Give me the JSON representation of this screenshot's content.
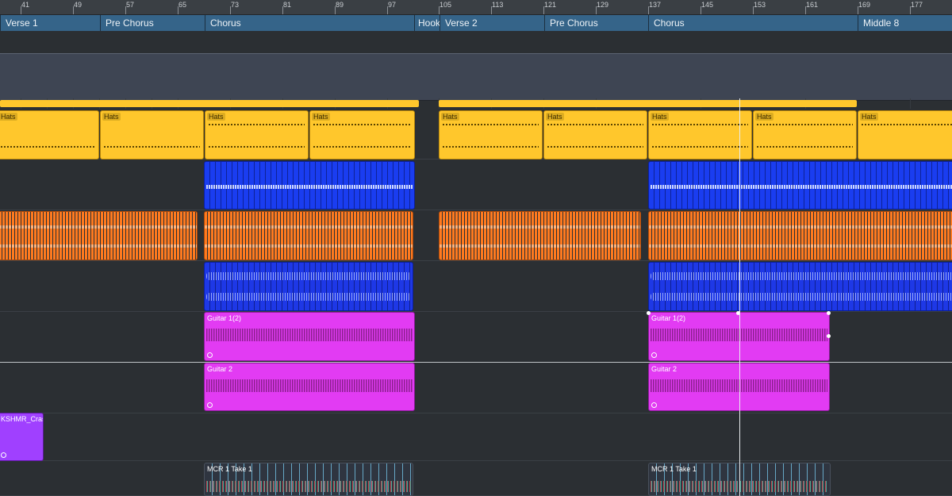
{
  "ruler": {
    "ticks": [
      "41",
      "49",
      "57",
      "65",
      "73",
      "81",
      "89",
      "97",
      "105",
      "113",
      "121",
      "129",
      "137",
      "145",
      "153",
      "161",
      "169",
      "177"
    ]
  },
  "markers": [
    {
      "label": "Verse 1"
    },
    {
      "label": "Pre Chorus"
    },
    {
      "label": "Chorus"
    },
    {
      "label": "Hook"
    },
    {
      "label": "Verse 2"
    },
    {
      "label": "Pre Chorus"
    },
    {
      "label": "Chorus"
    },
    {
      "label": "Middle 8"
    }
  ],
  "events": {
    "hats_label": "Hats",
    "guitar1_label": "Guitar 1(2)",
    "guitar2_label": "Guitar 2",
    "crash_label": "KSHMR_Cras",
    "mcr_label": "MCR 1 Take 1"
  },
  "colors": {
    "hats": "#ffc72c",
    "blue": "#1a3df0",
    "orange": "#ff7a1f",
    "pink": "#e23bf3",
    "purple": "#a040ff",
    "marker": "#356489"
  }
}
